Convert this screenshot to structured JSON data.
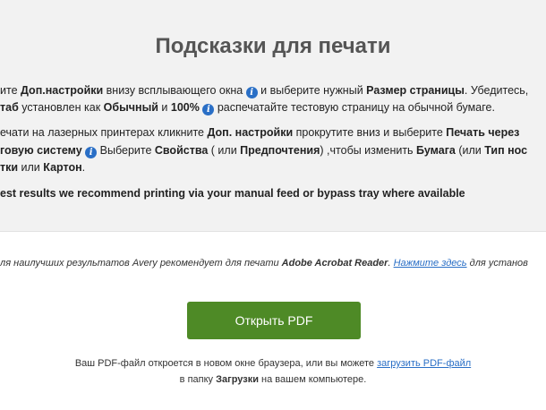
{
  "header": {
    "title": "Подсказки для печати"
  },
  "tips": {
    "tip1_line1": {
      "a": "ите ",
      "b1": "Доп.настройки",
      "c": " внизу всплывающего окна ",
      "d": " и выберите нужный ",
      "b2": "Размер страницы",
      "e": ". Убедитесь,"
    },
    "tip1_line2": {
      "b1": "таб",
      "a": " установлен как ",
      "b2": "Обычный",
      "c": " и ",
      "b3": "100%",
      "d": " распечатайте тестовую страницу на обычной бумаге."
    },
    "tip2_line1": {
      "a": "ечати на лазерных принтерах кликните ",
      "b1": "Доп. настройки",
      "c": " прокрутите вниз и выберите ",
      "b2": "Печать через"
    },
    "tip2_line2": {
      "b1": "говую систему",
      "a": " Выберите ",
      "b2": "Свойства",
      "c": " ( или ",
      "b3": "Предпочтения",
      "d": ") ,чтобы изменить ",
      "b4": "Бумага",
      "e": " (или ",
      "b5": "Тип нос"
    },
    "tip2_line3": {
      "b1": "тки",
      "a": " или ",
      "b2": "Картон",
      "c": "."
    },
    "en_note": "est results we recommend printing via your manual feed or bypass tray where available",
    "info_glyph": "i"
  },
  "reader_note": {
    "text": "ля наилучших результатов Avery рекомендует для печати ",
    "product": "Adobe Acrobat Reader",
    "sep": ". ",
    "link": "Нажмите здесь",
    "tail": " для установ"
  },
  "actions": {
    "open_pdf_label": "Открыть PDF"
  },
  "footer": {
    "line1_text": "Ваш PDF-файл откроется в новом окне браузера, или вы можете ",
    "download_link": "загрузить PDF-файл",
    "line2_a": "в папку ",
    "line2_bold": "Загрузки",
    "line2_b": " на вашем компьютере."
  },
  "colors": {
    "accent_blue": "#2a6fc6",
    "button_green": "#4e8a26",
    "panel_bg": "#f2f2f2"
  }
}
